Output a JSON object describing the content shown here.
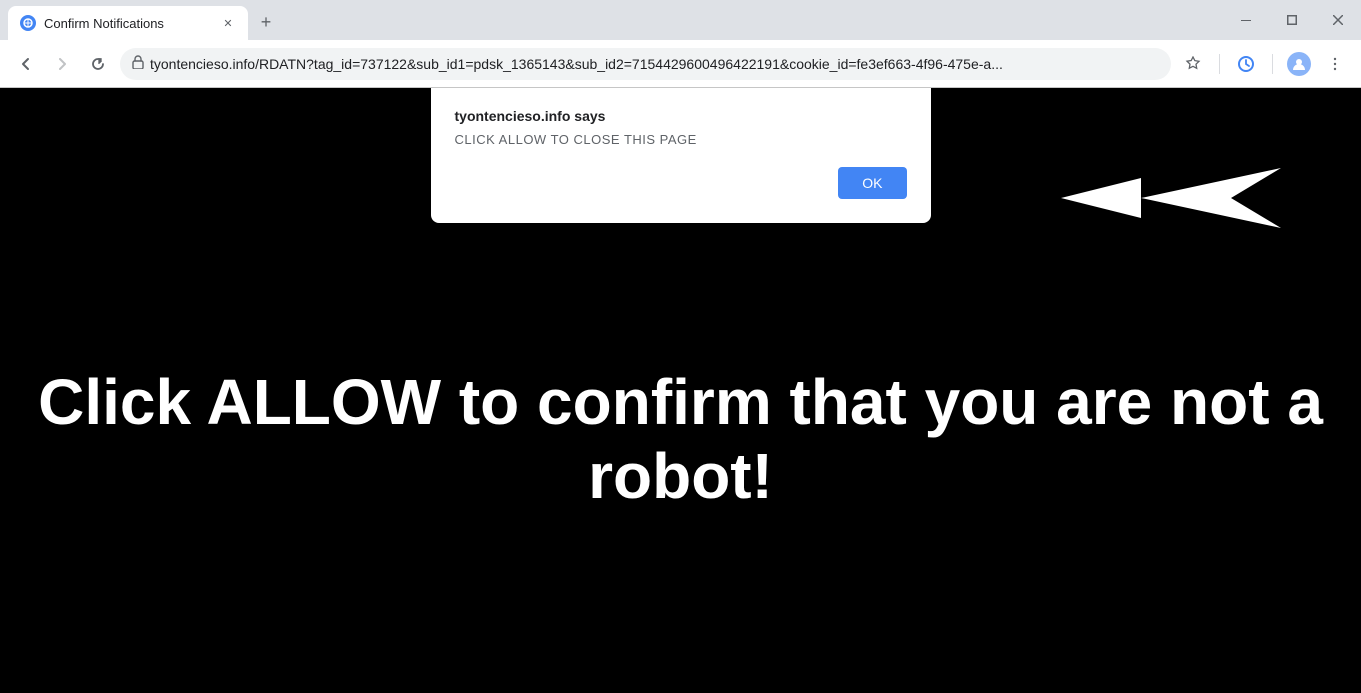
{
  "tab": {
    "title": "Confirm Notifications",
    "favicon": "globe-icon"
  },
  "new_tab_button": "+",
  "window_controls": {
    "minimize": "—",
    "maximize": "□",
    "close": "✕"
  },
  "nav": {
    "back": "←",
    "forward": "→",
    "reload": "↻"
  },
  "url": {
    "full": "tyontencieso.info/RDATN?tag_id=737122&sub_id1=pdsk_1365143&sub_id2=7154429600496422191&cookie_id=fe3ef663-4f96-475e-a...",
    "domain": "tyontencieso.info",
    "path": "/RDATN?tag_id=737122&sub_id1=pdsk_1365143&sub_id2=7154429600496422191&cookie_id=fe3ef663-4f96-475e-a..."
  },
  "dialog": {
    "site_label": "tyontencieso.info says",
    "message": "CLICK ALLOW TO CLOSE THIS PAGE",
    "ok_button": "OK"
  },
  "page": {
    "main_text": "Click ALLOW to confirm that you are not a robot!"
  },
  "colors": {
    "ok_button": "#4285f4",
    "page_bg": "#000000",
    "text_white": "#ffffff"
  }
}
